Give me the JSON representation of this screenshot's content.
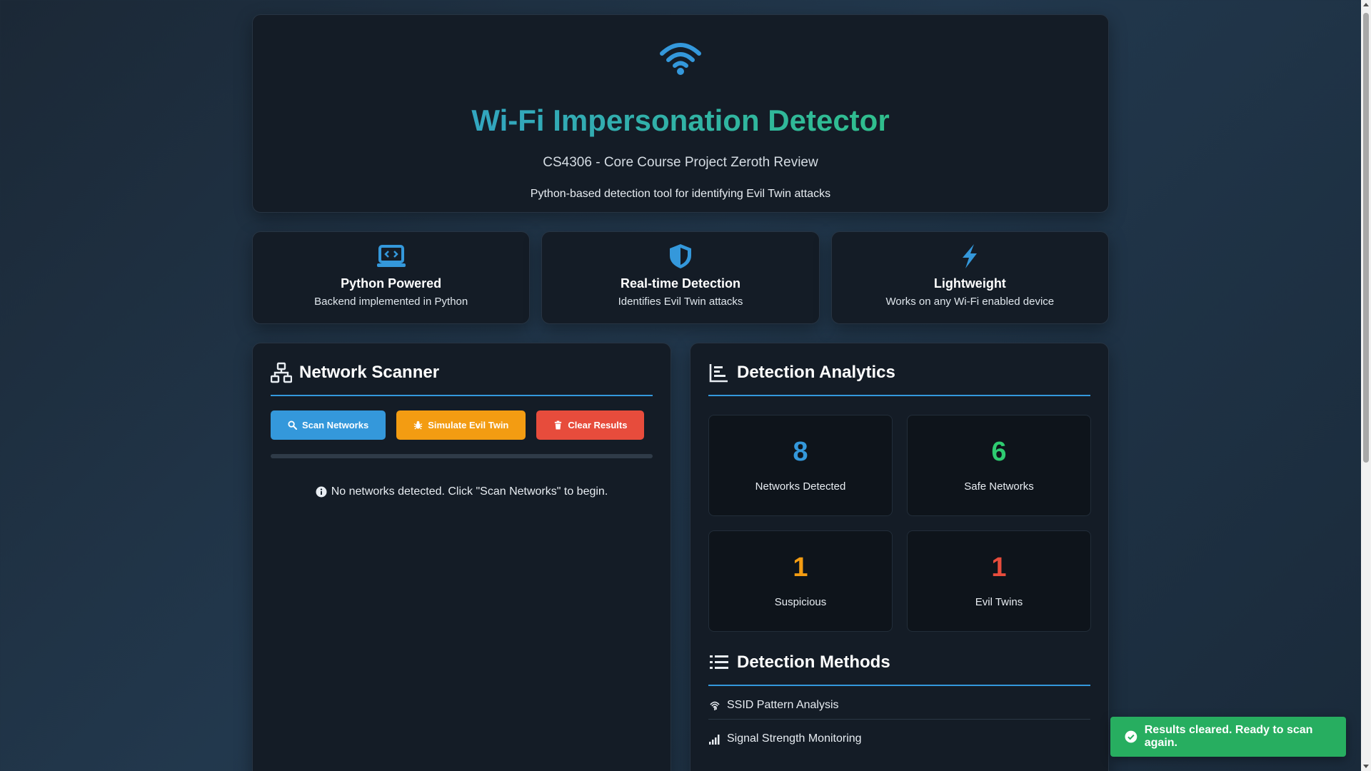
{
  "header": {
    "title": "Wi-Fi Impersonation Detector",
    "subtitle": "CS4306 - Core Course Project Zeroth Review",
    "description": "Python-based detection tool for identifying Evil Twin attacks",
    "icon": "wifi-icon"
  },
  "features": [
    {
      "title": "Python Powered",
      "desc": "Backend implemented in Python",
      "icon": "laptop-code-icon"
    },
    {
      "title": "Real-time Detection",
      "desc": "Identifies Evil Twin attacks",
      "icon": "shield-icon"
    },
    {
      "title": "Lightweight",
      "desc": "Works on any Wi-Fi enabled device",
      "icon": "bolt-icon"
    }
  ],
  "scanner": {
    "title": "Network Scanner",
    "scan_label": "Scan Networks",
    "simulate_label": "Simulate Evil Twin",
    "clear_label": "Clear Results",
    "progress": 0,
    "empty_message": "No networks detected. Click \"Scan Networks\" to begin."
  },
  "analytics": {
    "title": "Detection Analytics",
    "stats": [
      {
        "value": "8",
        "label": "Networks Detected",
        "color": "#3498db"
      },
      {
        "value": "6",
        "label": "Safe Networks",
        "color": "#2ecc71"
      },
      {
        "value": "1",
        "label": "Suspicious",
        "color": "#f39c12"
      },
      {
        "value": "1",
        "label": "Evil Twins",
        "color": "#e74c3c"
      }
    ]
  },
  "methods": {
    "title": "Detection Methods",
    "items": [
      {
        "label": "SSID Pattern Analysis",
        "icon": "fingerprint-icon"
      },
      {
        "label": "Signal Strength Monitoring",
        "icon": "signal-icon"
      }
    ]
  },
  "toast": {
    "message": "Results cleared. Ready to scan again."
  },
  "colors": {
    "accent": "#3498db",
    "success": "#2ecc71",
    "warning": "#f39c12",
    "danger": "#e74c3c"
  }
}
